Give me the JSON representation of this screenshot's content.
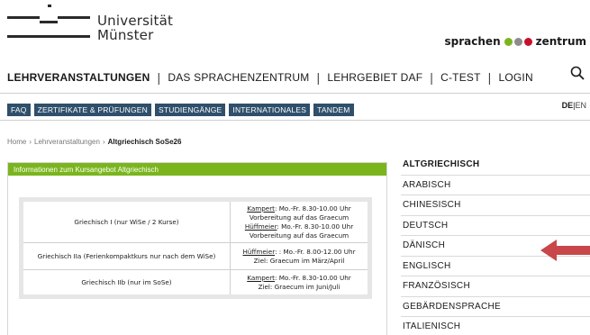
{
  "logo": {
    "line1": "Universität",
    "line2": "Münster"
  },
  "brand": {
    "left": "sprachen",
    "right": "zentrum",
    "dot_colors": [
      "#7ab51d",
      "#8c8c8c",
      "#c8102e"
    ]
  },
  "mainnav": {
    "items": [
      "LEHRVERANSTALTUNGEN",
      "DAS SPRACHENZENTRUM",
      "LEHRGEBIET DAF",
      "C-TEST",
      "LOGIN"
    ],
    "separator": "|"
  },
  "search": {
    "icon": "search-icon"
  },
  "subnav": {
    "items": [
      "FAQ",
      "ZERTIFIKATE & PRÜFUNGEN",
      "STUDIENGÄNGE",
      "INTERNATIONALES",
      "TANDEM"
    ]
  },
  "lang": {
    "de": "DE",
    "sep": "|",
    "en": "EN"
  },
  "breadcrumb": {
    "items": [
      "Home",
      "Lehrveranstaltungen",
      "Altgriechisch SoSe26"
    ],
    "separator": "›"
  },
  "infobox": {
    "title": "Informationen zum Kursangebot Altgriechisch",
    "rows": [
      {
        "course": "Griechisch I (nur WiSe / 2 Kurse)",
        "lines": [
          {
            "name": "Kampert",
            "text": ": Mo.-Fr. 8.30-10.00 Uhr"
          },
          {
            "name": "",
            "text": "Vorbereitung auf das Graecum"
          },
          {
            "name": "Hüffmeier",
            "text": ": Mo.-Fr. 8.30-10.00 Uhr"
          },
          {
            "name": "",
            "text": "Vorbereitung auf das Graecum"
          }
        ]
      },
      {
        "course": "Griechisch IIa (Ferienkompaktkurs nur nach dem WiSe)",
        "lines": [
          {
            "name": "Hüffmeier",
            "text": ": : Mo.-Fr. 8.00-12.00 Uhr"
          },
          {
            "name": "",
            "text": "Ziel: Graecum im März/April"
          }
        ]
      },
      {
        "course": "Griechisch IIb (nur im SoSe)",
        "lines": [
          {
            "name": "Kampert",
            "text": ": Mo.-Fr. 8.30-10.00 Uhr"
          },
          {
            "name": "",
            "text": "Ziel: Graecum im Juni/Juli"
          }
        ]
      }
    ]
  },
  "sidebar": {
    "items": [
      "ALTGRIECHISCH",
      "ARABISCH",
      "CHINESISCH",
      "DEUTSCH",
      "DÄNISCH",
      "ENGLISCH",
      "FRANZÖSISCH",
      "GEBÄRDENSPRACHE",
      "ITALIENISCH"
    ]
  },
  "colors": {
    "green": "#7ab51d",
    "navy": "#2f4f6b",
    "arrow": "#c8474a"
  }
}
